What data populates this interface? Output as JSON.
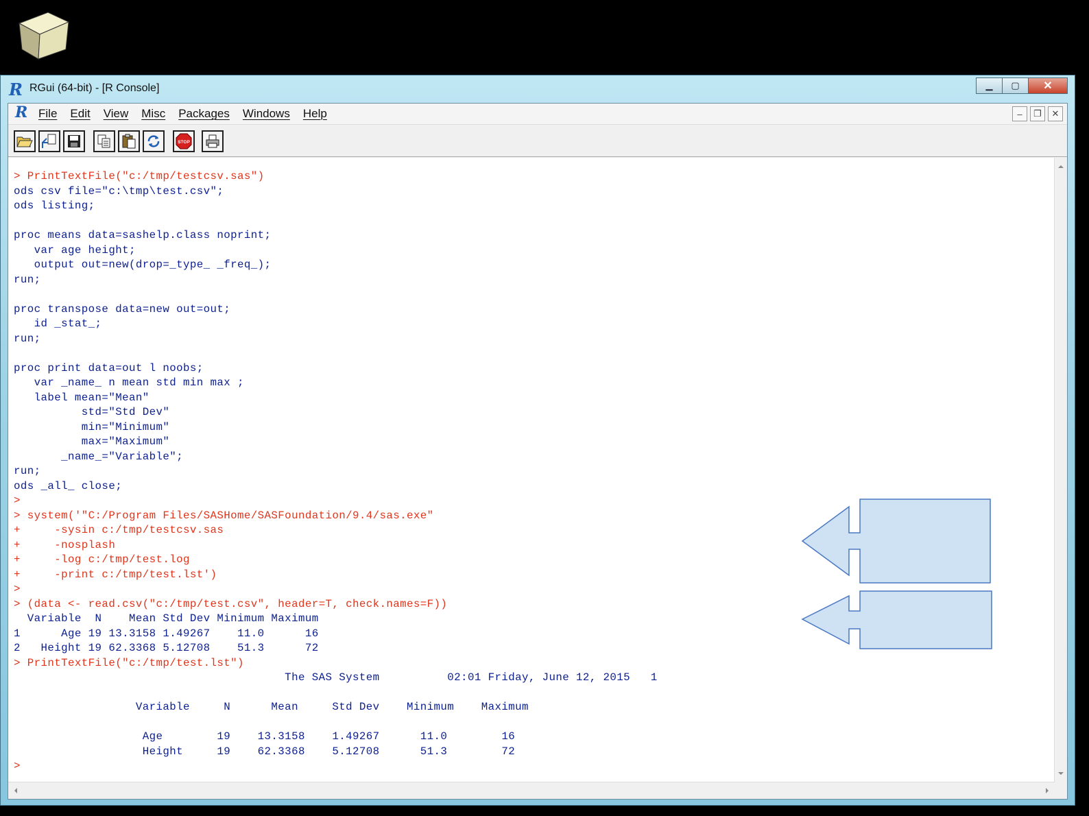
{
  "window": {
    "title": "RGui (64-bit) - [R Console]",
    "controls": {
      "minimize": "▁",
      "maximize": "▢",
      "close": "✕"
    }
  },
  "menu": {
    "items": [
      "File",
      "Edit",
      "View",
      "Misc",
      "Packages",
      "Windows",
      "Help"
    ],
    "mdi_controls": {
      "minimize": "–",
      "restore": "❐",
      "close": "✕"
    }
  },
  "toolbar": {
    "buttons": [
      "open-script",
      "load-workspace",
      "save-workspace",
      "copy",
      "paste",
      "copy-and-paste",
      "stop",
      "print"
    ],
    "stop_label": "STOP"
  },
  "console": {
    "lines": [
      {
        "text": "> PrintTextFile(\"c:/tmp/testcsv.sas\")",
        "type": "input"
      },
      {
        "text": "ods csv file=\"c:\\tmp\\test.csv\";",
        "type": "output"
      },
      {
        "text": "ods listing;",
        "type": "output"
      },
      {
        "text": "",
        "type": "output"
      },
      {
        "text": "proc means data=sashelp.class noprint;",
        "type": "output"
      },
      {
        "text": "   var age height;",
        "type": "output"
      },
      {
        "text": "   output out=new(drop=_type_ _freq_);",
        "type": "output"
      },
      {
        "text": "run;",
        "type": "output"
      },
      {
        "text": "",
        "type": "output"
      },
      {
        "text": "proc transpose data=new out=out;",
        "type": "output"
      },
      {
        "text": "   id _stat_;",
        "type": "output"
      },
      {
        "text": "run;",
        "type": "output"
      },
      {
        "text": "",
        "type": "output"
      },
      {
        "text": "proc print data=out l noobs;",
        "type": "output"
      },
      {
        "text": "   var _name_ n mean std min max ;",
        "type": "output"
      },
      {
        "text": "   label mean=\"Mean\"",
        "type": "output"
      },
      {
        "text": "          std=\"Std Dev\"",
        "type": "output"
      },
      {
        "text": "          min=\"Minimum\"",
        "type": "output"
      },
      {
        "text": "          max=\"Maximum\"",
        "type": "output"
      },
      {
        "text": "       _name_=\"Variable\";",
        "type": "output"
      },
      {
        "text": "run;",
        "type": "output"
      },
      {
        "text": "ods _all_ close;",
        "type": "output"
      },
      {
        "text": ">",
        "type": "input"
      },
      {
        "text": "> system('\"C:/Program Files/SASHome/SASFoundation/9.4/sas.exe\"",
        "type": "input"
      },
      {
        "text": "+     -sysin c:/tmp/testcsv.sas",
        "type": "input"
      },
      {
        "text": "+     -nosplash",
        "type": "input"
      },
      {
        "text": "+     -log c:/tmp/test.log",
        "type": "input"
      },
      {
        "text": "+     -print c:/tmp/test.lst')",
        "type": "input"
      },
      {
        "text": ">",
        "type": "input"
      },
      {
        "text": "> (data <- read.csv(\"c:/tmp/test.csv\", header=T, check.names=F))",
        "type": "input"
      },
      {
        "text": "  Variable  N    Mean Std Dev Minimum Maximum",
        "type": "output"
      },
      {
        "text": "1      Age 19 13.3158 1.49267    11.0      16",
        "type": "output"
      },
      {
        "text": "2   Height 19 62.3368 5.12708    51.3      72",
        "type": "output"
      },
      {
        "text": "> PrintTextFile(\"c:/tmp/test.lst\")",
        "type": "input"
      },
      {
        "text": "                                        The SAS System          02:01 Friday, June 12, 2015   1",
        "type": "output"
      },
      {
        "text": "",
        "type": "output"
      },
      {
        "text": "                  Variable     N      Mean     Std Dev    Minimum    Maximum",
        "type": "output"
      },
      {
        "text": "",
        "type": "output"
      },
      {
        "text": "                   Age        19    13.3158    1.49267      11.0        16",
        "type": "output"
      },
      {
        "text": "                   Height     19    62.3368    5.12708      51.3        72",
        "type": "output"
      },
      {
        "text": ">",
        "type": "input"
      }
    ]
  },
  "colors": {
    "input_text": "#e0341b",
    "output_text": "#0b1f8f",
    "callout_fill": "#cfe2f3",
    "callout_stroke": "#4a78c2"
  }
}
